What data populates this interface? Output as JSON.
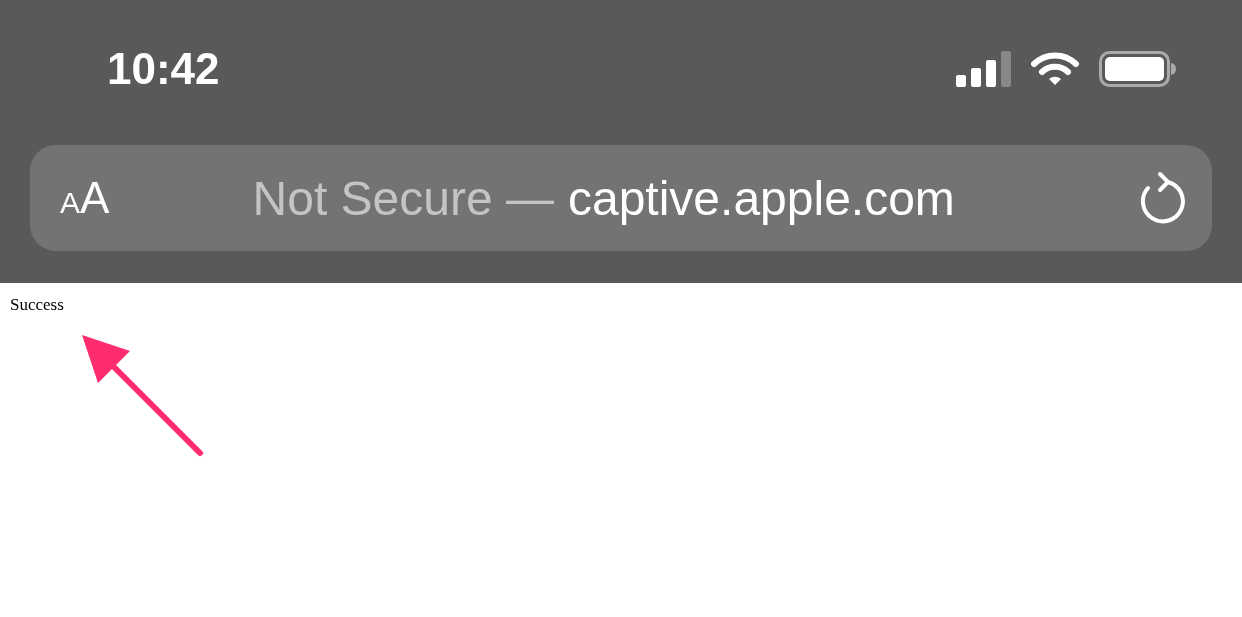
{
  "status_bar": {
    "time": "10:42"
  },
  "address_bar": {
    "text_size_label": "AA",
    "security_label": "Not Secure —",
    "domain": "captive.apple.com"
  },
  "page": {
    "text": "Success"
  }
}
